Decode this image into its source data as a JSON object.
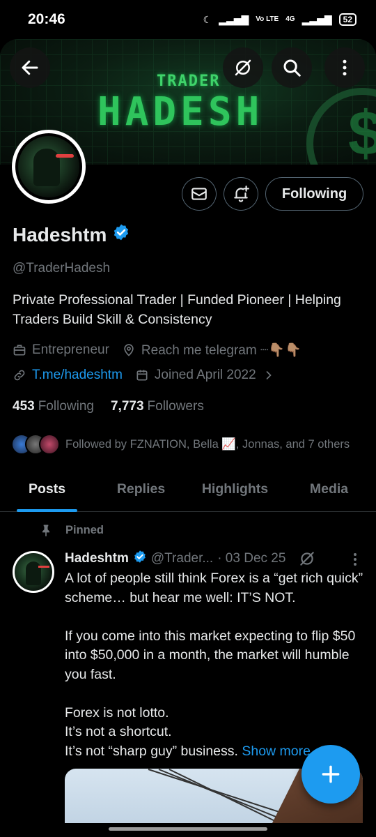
{
  "status_bar": {
    "time": "20:46",
    "battery": "52",
    "network": "4G",
    "volte": "Vo LTE"
  },
  "banner": {
    "small_text": "TRADER",
    "big_text": "HADESH"
  },
  "profile": {
    "name": "Hadeshtm",
    "handle": "@TraderHadesh",
    "bio": "Private Professional Trader | Funded Pioneer | Helping Traders Build Skill & Consistency",
    "category": "Entrepreneur",
    "location": "Reach me telegram ┈👇🏽👇🏽",
    "website": "T.me/hadeshtm",
    "joined": "Joined April 2022",
    "following_count": "453",
    "following_label": "Following",
    "followers_count": "7,773",
    "followers_label": "Followers",
    "followed_by": "Followed by FZNATION, Bella 📈, Jonnas, and 7 others"
  },
  "actions": {
    "following_button": "Following"
  },
  "tabs": [
    {
      "label": "Posts",
      "active": true
    },
    {
      "label": "Replies",
      "active": false
    },
    {
      "label": "Highlights",
      "active": false
    },
    {
      "label": "Media",
      "active": false
    }
  ],
  "pinned_post": {
    "pinned_label": "Pinned",
    "name": "Hadeshtm",
    "handle": "@Trader...",
    "date": "· 03 Dec 25",
    "paragraphs": [
      "A lot of people still think Forex is a “get rich quick” scheme… but hear me well: IT’S NOT.",
      "If you come into this market expecting to flip $50 into $50,000 in a month, the market will humble you fast.",
      "Forex is not lotto."
    ],
    "line2": "It’s not a shortcut.",
    "line3": "It’s not “sharp guy” business.",
    "show_more": "Show more"
  },
  "colors": {
    "accent": "#1d9bf0",
    "text_primary": "#e7e9ea",
    "text_secondary": "#71767b",
    "background": "#000000",
    "banner_green": "#2fc45c"
  },
  "icons": [
    "back-arrow-icon",
    "grok-icon",
    "search-icon",
    "more-vertical-icon",
    "message-icon",
    "notification-bell-plus-icon",
    "verified-icon",
    "briefcase-icon",
    "location-icon",
    "link-icon",
    "calendar-icon",
    "chevron-right-icon",
    "pin-icon",
    "compose-plus-icon"
  ]
}
